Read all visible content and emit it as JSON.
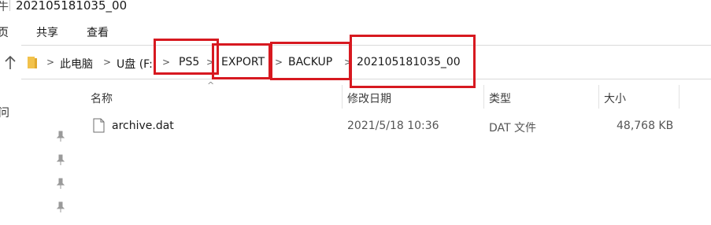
{
  "window": {
    "title": "202105181035_00",
    "title_clip": "牛"
  },
  "ribbon": {
    "tabs": [
      "页",
      "共享",
      "查看"
    ]
  },
  "address": {
    "crumbs": [
      "此电脑",
      "U盘 (F:)",
      "PS5",
      "EXPORT",
      "BACKUP",
      "202105181035_00"
    ],
    "crumb_u_disk_display": "U盘 (F:"
  },
  "columns": {
    "name": "名称",
    "modified": "修改日期",
    "type": "类型",
    "size": "大小"
  },
  "files": [
    {
      "name": "archive.dat",
      "modified": "2021/5/18 10:36",
      "type": "DAT 文件",
      "size": "48,768 KB"
    }
  ],
  "left_pane": {
    "clip_label": "问"
  },
  "highlight_color": "#d71920",
  "icons": [
    "up-arrow-icon",
    "folder-icon",
    "chevron-right-icon",
    "file-icon",
    "pin-icon",
    "sort-caret-icon"
  ]
}
